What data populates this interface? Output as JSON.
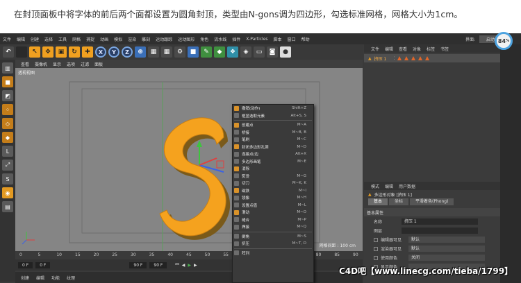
{
  "caption": "在封顶面板中将字体的前后两个面都设置为圆角封顶，类型由N-gons调为四边形，勾选标准网格，网格大小为1cm。",
  "menubar": {
    "items": [
      "文件",
      "编辑",
      "创建",
      "选择",
      "工具",
      "网格",
      "捕捉",
      "动画",
      "模拟",
      "渲染",
      "雕刻",
      "运动跟踪",
      "运动图形",
      "角色",
      "流水线",
      "插件",
      "X-Particles",
      "脚本",
      "窗口",
      "帮助"
    ],
    "layout_label": "界面:",
    "layout_value": "启动"
  },
  "viewport": {
    "menu": [
      "查看",
      "摄像机",
      "显示",
      "选项",
      "过滤",
      "面板"
    ],
    "label": "透视视图",
    "grid_scale": "网格间距 : 100 cm"
  },
  "object_panel": {
    "menu": [
      "文件",
      "编辑",
      "查看",
      "对象",
      "标签",
      "书签"
    ],
    "object_name": "挤压 1"
  },
  "gauge": {
    "value": "84",
    "unit": "%"
  },
  "attributes": {
    "menu": [
      "模式",
      "编辑",
      "用户数据"
    ],
    "title": "多边形对象 [挤压 1]",
    "tabs": [
      "基本",
      "坐标",
      "平滑着色(Phong)"
    ],
    "section": "基本属性",
    "rows": [
      {
        "label": "名称",
        "value": "挤压 1"
      },
      {
        "label": "图层",
        "value": ""
      },
      {
        "label": "编辑器可见",
        "value": "默认"
      },
      {
        "label": "渲染器可见",
        "value": "默认"
      },
      {
        "label": "使用颜色",
        "value": "关闭"
      },
      {
        "label": "显示颜色",
        "value": ""
      }
    ]
  },
  "timeline": {
    "ticks": [
      "0",
      "5",
      "10",
      "15",
      "20",
      "25",
      "30",
      "35",
      "40",
      "45",
      "50",
      "55",
      "60",
      "65",
      "70",
      "75",
      "80",
      "85",
      "90"
    ],
    "start_frame": "0 F",
    "current_frame": "0 F",
    "end_frame": "90 F",
    "end_frame2": "90 F"
  },
  "bottom_bar": [
    "创建",
    "编辑",
    "功能",
    "纹理"
  ],
  "context_menu": {
    "items": [
      {
        "label": "撤销(动作)",
        "shortcut": "Shift+Z"
      },
      {
        "label": "框显选取元素",
        "shortcut": "Alt+S, S"
      },
      {
        "sep": true
      },
      {
        "label": "创建点",
        "shortcut": "M~A"
      },
      {
        "label": "桥接",
        "shortcut": "M~B, B"
      },
      {
        "label": "笔刷",
        "shortcut": "M~C"
      },
      {
        "label": "封闭多边形孔洞",
        "shortcut": "M~D"
      },
      {
        "label": "连接点/边",
        "shortcut": "Alt+X"
      },
      {
        "label": "多边形画笔",
        "shortcut": "M~E"
      },
      {
        "label": "消除",
        "shortcut": ""
      },
      {
        "label": "熨烫",
        "shortcut": "M~G"
      },
      {
        "label": "切刀",
        "shortcut": "M~K, K"
      },
      {
        "label": "磁铁",
        "shortcut": "M~I"
      },
      {
        "label": "镜像",
        "shortcut": "M~H"
      },
      {
        "label": "设置点值",
        "shortcut": "M~L"
      },
      {
        "label": "滑动",
        "shortcut": "M~O"
      },
      {
        "label": "缝合",
        "shortcut": "M~P"
      },
      {
        "label": "焊接",
        "shortcut": "M~Q"
      },
      {
        "sep": true
      },
      {
        "label": "倒角",
        "shortcut": "M~S"
      },
      {
        "label": "挤压",
        "shortcut": "M~T, D"
      },
      {
        "sep": true
      },
      {
        "label": "阵列",
        "shortcut": ""
      }
    ]
  },
  "watermark": "C4D吧【www.linecg.com/tieba/1799】",
  "colors": {
    "font_orange": "#f5a21e",
    "viewport_bg": "#858585",
    "panel_bg": "#3b3b3b"
  }
}
